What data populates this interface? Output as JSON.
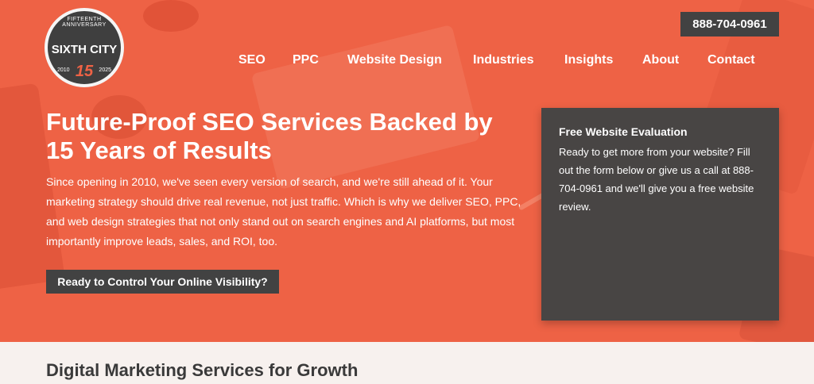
{
  "header": {
    "logo": {
      "ring_text": "FIFTEENTH ANNIVERSARY",
      "brand": "SIXTH CITY",
      "year_start": "2010",
      "year_end": "2025",
      "anniversary": "15"
    },
    "phone": "888-704-0961"
  },
  "nav": {
    "items": [
      "SEO",
      "PPC",
      "Website Design",
      "Industries",
      "Insights",
      "About",
      "Contact"
    ]
  },
  "hero": {
    "headline": "Future-Proof SEO Services Backed by 15 Years of Results",
    "intro": "Since opening in 2010, we've seen every version of search, and we're still ahead of it. Your marketing strategy should drive real revenue, not just traffic. Which is why we deliver SEO, PPC, and web design strategies that not only stand out on search engines and AI platforms, but most importantly improve leads, sales, and ROI, too.",
    "cta_label": "Ready to Control Your Online Visibility?"
  },
  "evaluation": {
    "title": "Free Website Evaluation",
    "body": "Ready to get more from your website? Fill out the form below or give us a call at 888-704-0961 and we'll give you a free website review."
  },
  "section": {
    "title": "Digital Marketing Services for Growth"
  },
  "colors": {
    "accent": "#ee6245",
    "dark": "#424242",
    "card": "#484544"
  }
}
